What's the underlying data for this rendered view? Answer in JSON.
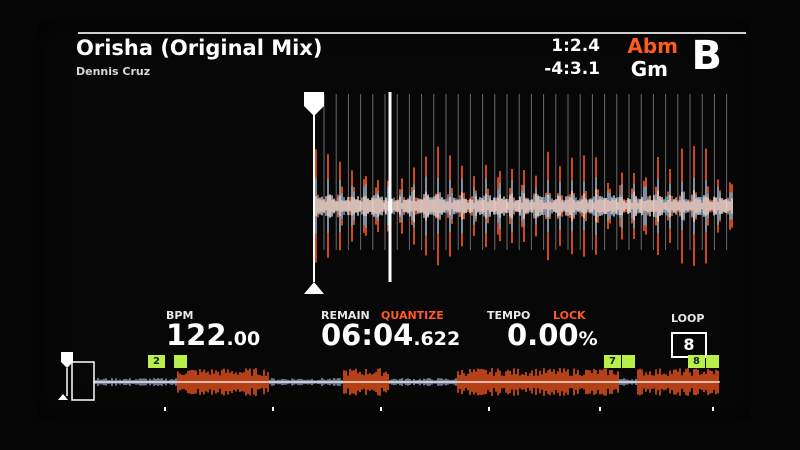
{
  "track": {
    "title": "Orisha (Original Mix)",
    "artist": "Dennis Cruz"
  },
  "time": {
    "elapsed": "1:2.4",
    "remaining": "-4:3.1"
  },
  "key": {
    "original": "Abm",
    "current": "Gm"
  },
  "deck": "B",
  "bpm": {
    "label": "BPM",
    "integer": "122",
    "decimal": ".00"
  },
  "remain": {
    "label": "REMAIN",
    "quantize_label": "QUANTIZE",
    "main": "06:04",
    "fraction": ".622"
  },
  "tempo": {
    "label": "TEMPO",
    "lock_label": "LOCK",
    "value": "0.00",
    "unit": "%"
  },
  "loop": {
    "label": "LOOP",
    "value": "8"
  },
  "hot_cues": [
    {
      "label": "2"
    },
    {
      "label": ""
    },
    {
      "label": "7"
    },
    {
      "label": ""
    },
    {
      "label": "8"
    },
    {
      "label": ""
    }
  ],
  "colors": {
    "accent_orange": "#ff5a1f",
    "wave_white": "#ffffff",
    "wave_blue": "#6fc7ff",
    "cue_green": "#b8ef4a"
  }
}
